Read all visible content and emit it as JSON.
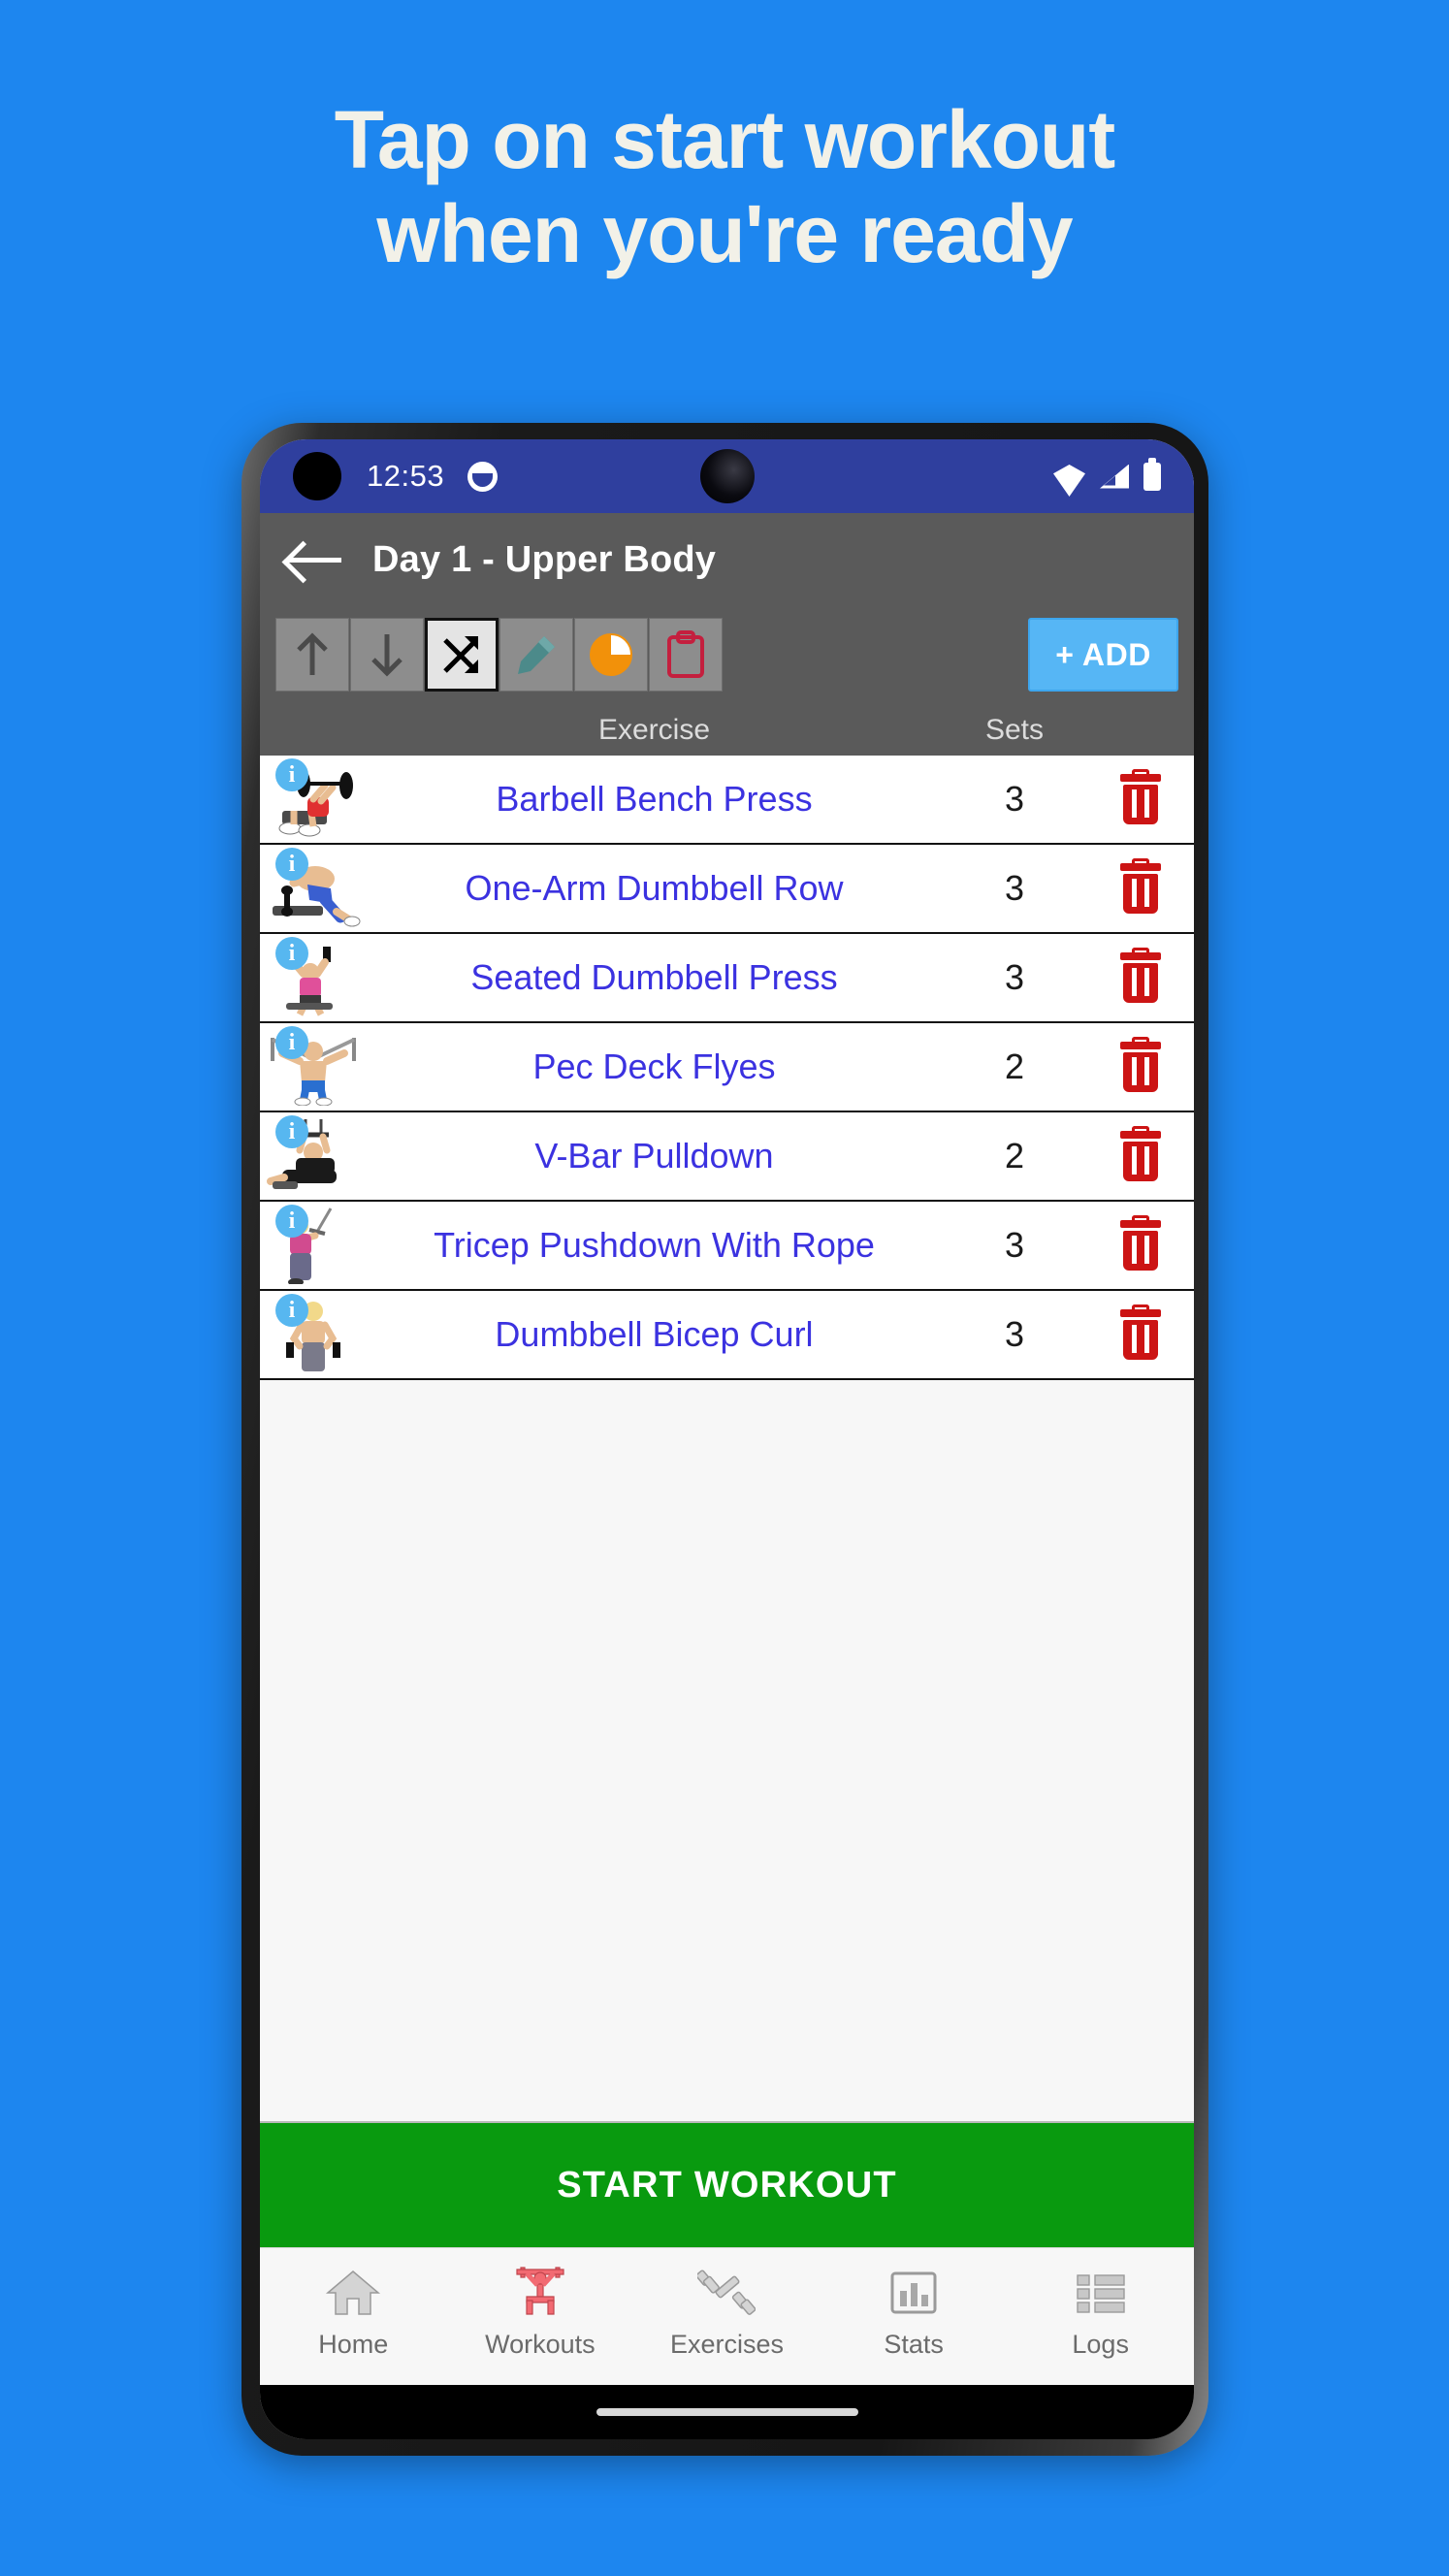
{
  "promo": {
    "line1": "Tap on start workout",
    "line2": "when you're ready",
    "background_color": "#1d86ef",
    "text_color": "#f2f1e8"
  },
  "status_bar": {
    "time": "12:53",
    "notification_icon": "notification-dot-icon",
    "wifi_icon": "wifi-icon",
    "signal_icon": "cellular-signal-icon",
    "battery_icon": "battery-icon",
    "background_color": "#2f3f9e"
  },
  "app_bar": {
    "back_icon": "back-arrow-icon",
    "title": "Day 1 - Upper Body",
    "background_color": "#5a5a5a"
  },
  "toolbar": {
    "buttons": [
      {
        "name": "move-up-button",
        "icon": "arrow-up-icon",
        "active": false
      },
      {
        "name": "move-down-button",
        "icon": "arrow-down-icon",
        "active": false
      },
      {
        "name": "shuffle-button",
        "icon": "shuffle-icon",
        "active": true
      },
      {
        "name": "edit-button",
        "icon": "pencil-icon",
        "active": false
      },
      {
        "name": "chart-button",
        "icon": "pie-chart-icon",
        "active": false
      },
      {
        "name": "notes-button",
        "icon": "clipboard-icon",
        "active": false
      }
    ],
    "add_label": "+ ADD",
    "add_color": "#56b6f5"
  },
  "table": {
    "headers": {
      "exercise": "Exercise",
      "sets": "Sets"
    },
    "rows": [
      {
        "info": "i",
        "name": "Barbell Bench Press",
        "sets": "3",
        "thumb": "bench-press-thumb",
        "delete_icon": "trash-icon"
      },
      {
        "info": "i",
        "name": "One-Arm Dumbbell Row",
        "sets": "3",
        "thumb": "dumbbell-row-thumb",
        "delete_icon": "trash-icon"
      },
      {
        "info": "i",
        "name": "Seated Dumbbell Press",
        "sets": "3",
        "thumb": "dumbbell-press-thumb",
        "delete_icon": "trash-icon"
      },
      {
        "info": "i",
        "name": "Pec Deck Flyes",
        "sets": "2",
        "thumb": "pec-deck-thumb",
        "delete_icon": "trash-icon"
      },
      {
        "info": "i",
        "name": "V-Bar Pulldown",
        "sets": "2",
        "thumb": "pulldown-thumb",
        "delete_icon": "trash-icon"
      },
      {
        "info": "i",
        "name": "Tricep Pushdown With Rope",
        "sets": "3",
        "thumb": "tricep-pushdown-thumb",
        "delete_icon": "trash-icon"
      },
      {
        "info": "i",
        "name": "Dumbbell Bicep Curl",
        "sets": "3",
        "thumb": "bicep-curl-thumb",
        "delete_icon": "trash-icon"
      }
    ],
    "name_color": "#3b32e0"
  },
  "start_button": {
    "label": "START WORKOUT",
    "color": "#099a0f"
  },
  "bottom_nav": {
    "items": [
      {
        "label": "Home",
        "icon": "home-icon",
        "active": false
      },
      {
        "label": "Workouts",
        "icon": "lifter-icon",
        "active": true
      },
      {
        "label": "Exercises",
        "icon": "dumbbell-icon",
        "active": false
      },
      {
        "label": "Stats",
        "icon": "bar-chart-icon",
        "active": false
      },
      {
        "label": "Logs",
        "icon": "list-icon",
        "active": false
      }
    ],
    "active_color": "#f26a72"
  }
}
